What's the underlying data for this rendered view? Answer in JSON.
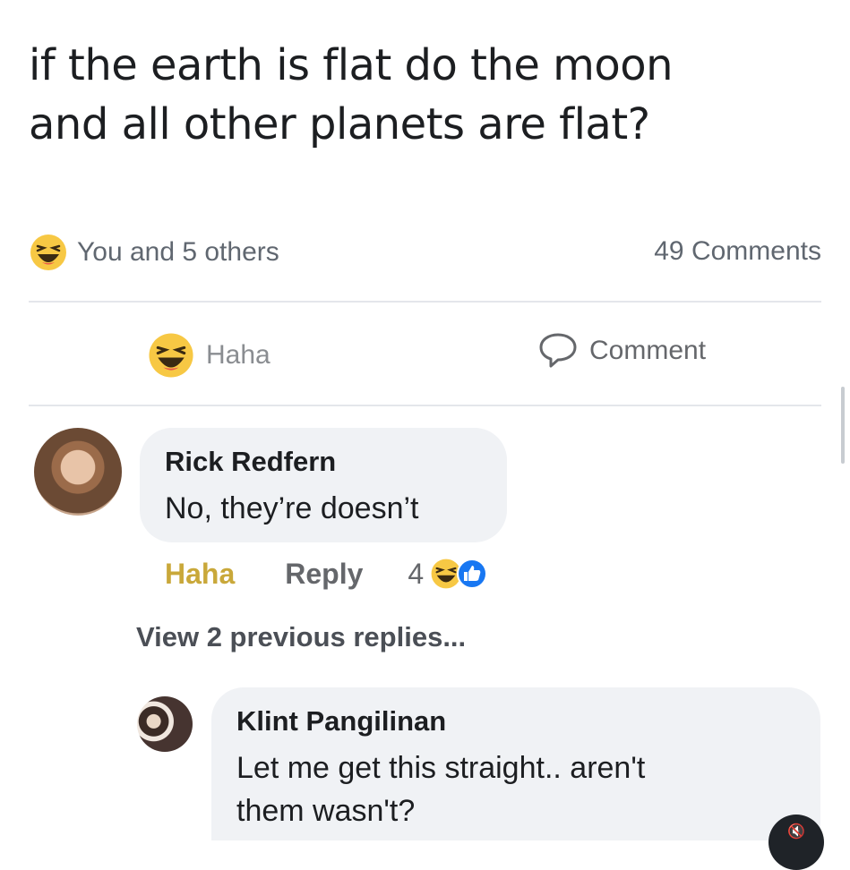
{
  "post": {
    "text_line1": "if the earth is flat do the moon",
    "text_line2": "and all other planets are flat?"
  },
  "stats": {
    "reactors": "You and 5 others",
    "comments_count": "49 Comments"
  },
  "actions": {
    "haha_label": "Haha",
    "comment_label": "Comment"
  },
  "comments": [
    {
      "author": "Rick Redfern",
      "text": "No, they’re doesn’t",
      "haha_label": "Haha",
      "reply_label": "Reply",
      "reaction_count": "4"
    }
  ],
  "view_previous_replies": "View 2 previous replies...",
  "replies": [
    {
      "author": "Klint Pangilinan",
      "text_line1": "Let me get this straight.. aren't",
      "text_line2": "them wasn't?"
    }
  ],
  "icons": {
    "haha": "laughing-emoji-icon",
    "like": "thumbs-up-icon",
    "comment": "speech-bubble-icon",
    "mute": "muted-speaker-icon"
  },
  "colors": {
    "haha_gold": "#c9a83a",
    "like_blue": "#1877f2",
    "text": "#1c1e21",
    "muted_text": "#65676b",
    "bubble": "#f0f2f5"
  }
}
